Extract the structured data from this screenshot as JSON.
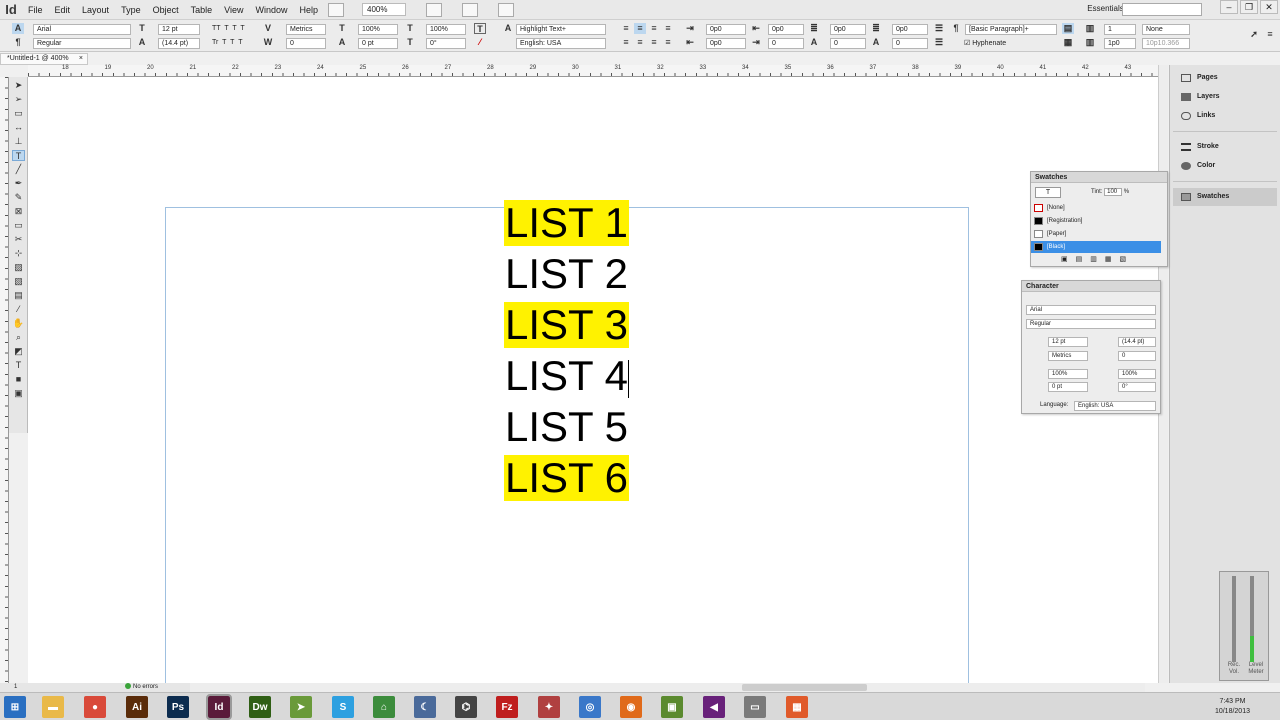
{
  "app": {
    "logo": "Id"
  },
  "menu": [
    "File",
    "Edit",
    "Layout",
    "Type",
    "Object",
    "Table",
    "View",
    "Window",
    "Help"
  ],
  "toolbar": {
    "zoom": "400%",
    "workspace": "Essentials",
    "workspace_caret": "▾"
  },
  "window_buttons": [
    "–",
    "❐",
    "✕"
  ],
  "control": {
    "font": "Arial",
    "style": "Regular",
    "size": "12 pt",
    "leading": "(14.4 pt)",
    "kerning": "Metrics",
    "tracking": "0",
    "vscale": "100%",
    "hscale": "100%",
    "baseline": "0 pt",
    "skew": "0°",
    "highlight": "Highlight Text+",
    "language": "English: USA",
    "indent_left": "0p0",
    "indent_first": "0p0",
    "space_before": "0p0",
    "space_after": "0p0",
    "right_indent_top": "0p0",
    "right_indent_bottom": "0",
    "para_style": "[Basic Paragraph]+",
    "hyphenate": "Hyphenate",
    "columns": "1",
    "gutter": "1p0",
    "stroke_none": "None",
    "width_val": "10p10.366",
    "caps_labels": [
      "TT",
      "T",
      "T",
      "T"
    ],
    "caps_labels2": [
      "Tr",
      "T",
      "T",
      "T"
    ]
  },
  "document_tab": {
    "title": "*Untitled-1 @ 400%",
    "close": "×"
  },
  "ruler_numbers": [
    "18",
    "19",
    "20",
    "21",
    "22",
    "23",
    "24",
    "25",
    "26",
    "27",
    "28",
    "29",
    "30",
    "31",
    "32",
    "33",
    "34",
    "35",
    "36",
    "37",
    "38",
    "39",
    "40",
    "41",
    "42",
    "43"
  ],
  "list_items": [
    {
      "text": "LIST 1",
      "highlight": true
    },
    {
      "text": "LIST 2",
      "highlight": false
    },
    {
      "text": "LIST 3",
      "highlight": true
    },
    {
      "text": "LIST 4",
      "highlight": false
    },
    {
      "text": "LIST 5",
      "highlight": false
    },
    {
      "text": "LIST 6",
      "highlight": true
    }
  ],
  "highlight_color": "#fff200",
  "dock": {
    "items": [
      "Pages",
      "Layers",
      "Links"
    ],
    "items2": [
      "Stroke",
      "Color"
    ],
    "items3": [
      "Swatches"
    ]
  },
  "swatches": {
    "title": "Swatches",
    "tint_label": "Tint:",
    "tint": "100",
    "tint_unit": "%",
    "rows": [
      {
        "name": "[None]",
        "color": "#ffffff"
      },
      {
        "name": "[Registration]",
        "color": "#000000"
      },
      {
        "name": "[Paper]",
        "color": "#ffffff"
      },
      {
        "name": "[Black]",
        "color": "#000000"
      }
    ]
  },
  "character": {
    "title": "Character",
    "font": "Arial",
    "style": "Regular",
    "size": "12 pt",
    "leading": "(14.4 pt)",
    "kerning": "Metrics",
    "tracking": "0",
    "vscale": "100%",
    "hscale": "100%",
    "baseline": "0 pt",
    "skew": "0°",
    "language_label": "Language:",
    "language": "English: USA"
  },
  "status": {
    "page": "1",
    "preflight": "No errors"
  },
  "meter": {
    "left_label": "Rec. Vol.",
    "right_label": "Level Meter"
  },
  "taskbar": {
    "apps": [
      {
        "name": "windows-start",
        "label": "⊞",
        "color": "#2a6fc1"
      },
      {
        "name": "file-explorer",
        "label": "▬",
        "color": "#e9b949"
      },
      {
        "name": "chrome",
        "label": "●",
        "color": "#d94a3a"
      },
      {
        "name": "illustrator",
        "label": "Ai",
        "color": "#5a2c0a"
      },
      {
        "name": "photoshop",
        "label": "Ps",
        "color": "#0c2c4f"
      },
      {
        "name": "indesign",
        "label": "Id",
        "color": "#5a1b3a"
      },
      {
        "name": "dreamweaver",
        "label": "Dw",
        "color": "#2f5e14"
      },
      {
        "name": "paper-plane",
        "label": "➤",
        "color": "#6a9a3a"
      },
      {
        "name": "app-blue-s",
        "label": "S",
        "color": "#2da0e0"
      },
      {
        "name": "home-app",
        "label": "⌂",
        "color": "#3c8c3c"
      },
      {
        "name": "moon-app",
        "label": "☾",
        "color": "#4a6a9a"
      },
      {
        "name": "dial-app",
        "label": "⌬",
        "color": "#444444"
      },
      {
        "name": "filezilla",
        "label": "Fz",
        "color": "#bf1e1e"
      },
      {
        "name": "share-app",
        "label": "✦",
        "color": "#b04040"
      },
      {
        "name": "safari-app",
        "label": "◎",
        "color": "#3a78c9"
      },
      {
        "name": "firefox",
        "label": "◉",
        "color": "#e06a1a"
      },
      {
        "name": "minecraft",
        "label": "▣",
        "color": "#5b8a2f"
      },
      {
        "name": "visual-studio",
        "label": "◀",
        "color": "#68217a"
      },
      {
        "name": "recorder",
        "label": "▭",
        "color": "#7a7a7a"
      },
      {
        "name": "tiles-app",
        "label": "▦",
        "color": "#e05a2a"
      }
    ],
    "time": "7:43 PM",
    "date": "10/18/2013"
  }
}
